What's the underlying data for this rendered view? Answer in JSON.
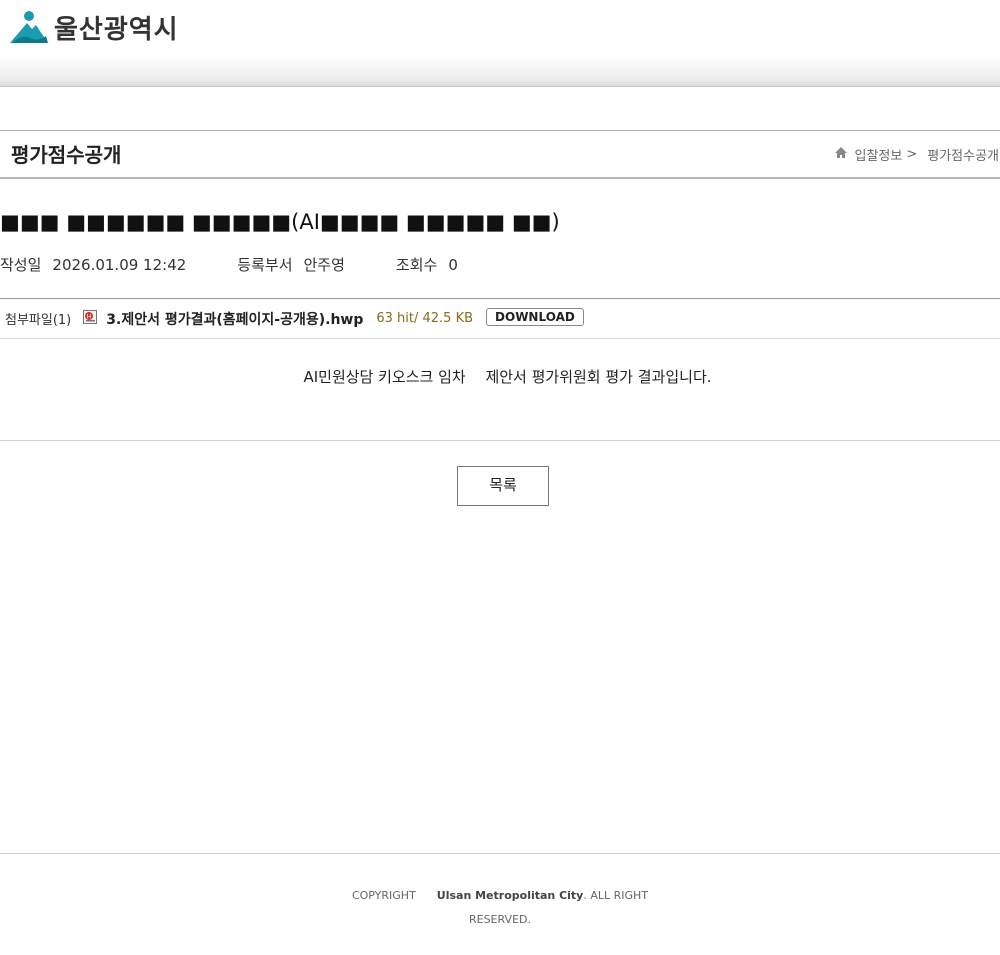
{
  "header": {
    "logo_text": "울산광역시"
  },
  "title_bar": {
    "page_title": "평가점수공개",
    "breadcrumb": {
      "item1": "입찰정보",
      "separator": ">",
      "item2": "평가점수공개"
    }
  },
  "post": {
    "title_prefix": "■■■ ■■■■■■ ■■■■■(AI",
    "title_suffix": "■■■■ ■■■■■ ■■)",
    "meta": {
      "date_label": "작성일",
      "date_value": "2026.01.09 12:42",
      "dept_label": "등록부서",
      "dept_value": "안주영",
      "views_label": "조회수",
      "views_value": "0"
    },
    "attachment": {
      "label": "첨부파일(1)",
      "file_name": "3.제안서 평가결과(홈페이지-공개용).hwp",
      "file_meta": "63 hit/ 42.5 KB",
      "download_label": "DOWNLOAD",
      "icon": "hwp-file-icon"
    },
    "body_text": "AI민원상담 키오스크 임차 　제안서 평가위원회 평가 결과입니다."
  },
  "actions": {
    "list_label": "목록"
  },
  "footer": {
    "copyright_label": "COPYRIGHT",
    "org_name": "Ulsan Metropolitan City",
    "rights": ". ALL RIGHT",
    "rights2": "RESERVED."
  },
  "colors": {
    "logo_teal": "#1a9bb0",
    "file_meta": "#8a6a1a"
  }
}
